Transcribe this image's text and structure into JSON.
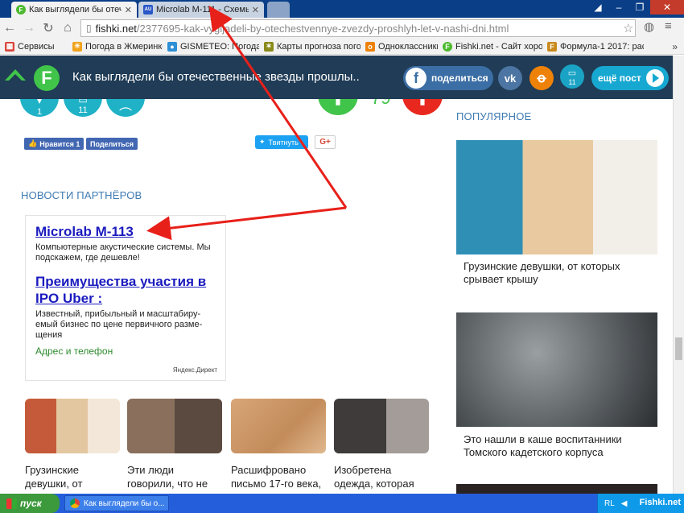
{
  "tabs": [
    {
      "label": "Как выглядели бы отечест",
      "icon": "fishki-favicon"
    },
    {
      "label": "Microlab M-111 - Схемы и Se",
      "icon": "audio-favicon"
    }
  ],
  "omnibox": {
    "host": "fishki.net",
    "path": "/2377695-kak-vygljadeli-by-otechestvennye-zvezdy-proshlyh-let-v-nashi-dni.html"
  },
  "bookmarks": [
    {
      "label": "Сервисы",
      "icon": "apps-icon",
      "color": "#d9453a"
    },
    {
      "label": "Погода в Жмеринке, п",
      "icon": "weather-icon",
      "color": "#f0a21b"
    },
    {
      "label": "GISMETEO: Погода в Ж",
      "icon": "gismeteo-icon",
      "color": "#2d8fd5"
    },
    {
      "label": "Карты прогноза погоди",
      "icon": "map-icon",
      "color": "#8a8a1a"
    },
    {
      "label": "Одноклассники",
      "icon": "ok-icon",
      "color": "#ee8208"
    },
    {
      "label": "Fishki.net - Сайт хорош",
      "icon": "fishki-icon",
      "color": "#4cba2e"
    },
    {
      "label": "Формула-1 2017: расп",
      "icon": "f1-icon",
      "color": "#c98a1c"
    }
  ],
  "header": {
    "logo": "F",
    "title": "Как выглядели бы отечественные звезды прошлы..",
    "share_label": "поделиться",
    "comment_count": "11",
    "more_label": "ещё пост"
  },
  "article_actions": {
    "bookmark_count": "1",
    "comment_count": "11",
    "rating": "79"
  },
  "social": {
    "fb_like": "Нравится 1",
    "fb_share": "Поделиться",
    "tweet": "Твитнуть",
    "gplus": "G+"
  },
  "partners": {
    "title": "НОВОСТИ ПАРТНЁРОВ",
    "ads": [
      {
        "title": "Microlab M-113",
        "text": "Компьютерные акустические системы. Мы подскажем, где дешевле!"
      },
      {
        "title": "Преимущества участия в IPO Uber :",
        "text": "Известный, прибыльный и масштабиру-емый бизнес по цене первичного разме-щения",
        "link": "Адрес и телефон"
      }
    ],
    "source": "Яндекс.Директ"
  },
  "related": [
    {
      "caption": "Грузинские девушки, от"
    },
    {
      "caption": "Эти люди говорили, что не"
    },
    {
      "caption": "Расшифровано письмо 17-го века,"
    },
    {
      "caption": "Изобретена одежда, которая"
    }
  ],
  "popular": {
    "title": "ПОПУЛЯРНОЕ",
    "items": [
      {
        "caption": "Грузинские девушки, от которых срывает крышу"
      },
      {
        "caption": "Это нашли в каше воспитанники Томского кадетского корпуса"
      }
    ]
  },
  "taskbar": {
    "start_label": "пуск",
    "task": "Как выглядели бы о...",
    "lang": "RL",
    "watermark": "Fishki.net"
  },
  "colors": {
    "brand_green": "#40c44a",
    "header_bg": "#203c56",
    "accent_teal": "#1fb2c7",
    "arrow_red": "#e8201a"
  }
}
